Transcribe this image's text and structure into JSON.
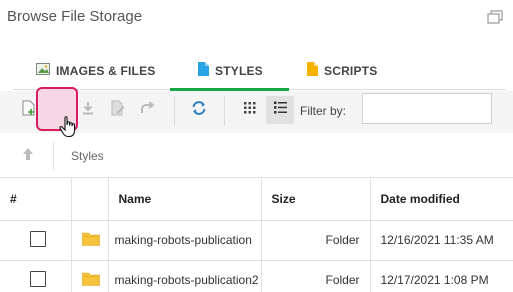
{
  "window": {
    "title": "Browse File Storage",
    "restore_icon": "restore-window-icon"
  },
  "tabs": [
    {
      "label": "IMAGES & FILES",
      "icon": "image-icon",
      "active": false
    },
    {
      "label": "STYLES",
      "icon": "css-file-icon",
      "active": true,
      "color": "#29a3e6"
    },
    {
      "label": "SCRIPTS",
      "icon": "js-file-icon",
      "active": false,
      "color": "#f4b400"
    }
  ],
  "accent_color": "#19a74a",
  "highlight_color": "#d81b60",
  "toolbar": {
    "filter_label": "Filter by:",
    "filter_value": "",
    "buttons": [
      "new-file-icon",
      "new-folder-icon",
      "download-icon",
      "edit-icon",
      "redo-icon",
      "refresh-icon",
      "grid-view-icon",
      "list-view-icon"
    ]
  },
  "breadcrumb": {
    "current": "Styles"
  },
  "table": {
    "headers": [
      "#",
      "",
      "Name",
      "Size",
      "Date modified"
    ],
    "rows": [
      {
        "name": "making-robots-publication",
        "size": "Folder",
        "date": "12/16/2021 11:35 AM"
      },
      {
        "name": "making-robots-publication2",
        "size": "Folder",
        "date": "12/17/2021 1:08 PM"
      }
    ]
  }
}
